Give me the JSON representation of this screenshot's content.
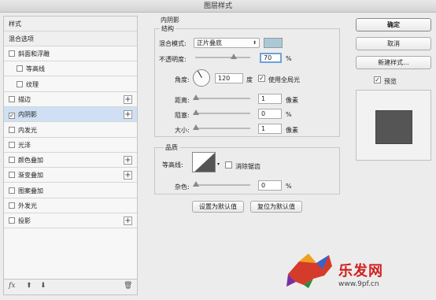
{
  "window": {
    "title": "图层样式"
  },
  "left_panel": {
    "header": "样式",
    "blend_options": "混合选项",
    "items": [
      {
        "label": "斜面和浮雕",
        "checked": false,
        "indent": false,
        "plus": false
      },
      {
        "label": "等高线",
        "checked": false,
        "indent": true,
        "plus": false
      },
      {
        "label": "纹理",
        "checked": false,
        "indent": true,
        "plus": false
      },
      {
        "label": "描边",
        "checked": false,
        "indent": false,
        "plus": true
      },
      {
        "label": "内阴影",
        "checked": true,
        "indent": false,
        "plus": true,
        "selected": true
      },
      {
        "label": "内发光",
        "checked": false,
        "indent": false,
        "plus": false
      },
      {
        "label": "光泽",
        "checked": false,
        "indent": false,
        "plus": false
      },
      {
        "label": "颜色叠加",
        "checked": false,
        "indent": false,
        "plus": true
      },
      {
        "label": "渐变叠加",
        "checked": false,
        "indent": false,
        "plus": true
      },
      {
        "label": "图案叠加",
        "checked": false,
        "indent": false,
        "plus": false
      },
      {
        "label": "外发光",
        "checked": false,
        "indent": false,
        "plus": false
      },
      {
        "label": "投影",
        "checked": false,
        "indent": false,
        "plus": true
      }
    ],
    "footer": {
      "fx": "fx",
      "up": "⬆",
      "down": "⬇",
      "trash": "🗑"
    }
  },
  "inner_shadow": {
    "section_title": "内阴影",
    "structure_title": "结构",
    "blend_mode_label": "混合模式:",
    "blend_mode_value": "正片叠底",
    "shadow_color": "#a9c9d6",
    "opacity_label": "不透明度:",
    "opacity_value": "70",
    "opacity_unit": "%",
    "opacity_level": 0.7,
    "angle_label": "角度:",
    "angle_value": "120",
    "angle_unit": "度",
    "global_light_label": "使用全局光",
    "global_light_checked": true,
    "distance_label": "距离:",
    "distance_value": "1",
    "distance_unit": "像素",
    "choke_label": "阻塞:",
    "choke_value": "0",
    "choke_unit": "%",
    "size_label": "大小:",
    "size_value": "1",
    "size_unit": "像素",
    "quality_title": "品质",
    "contour_label": "等高线:",
    "antialias_label": "消除锯齿",
    "antialias_checked": false,
    "noise_label": "杂色:",
    "noise_value": "0",
    "noise_unit": "%",
    "make_default_label": "设置为默认值",
    "reset_default_label": "复位为默认值"
  },
  "right_panel": {
    "ok_label": "确定",
    "cancel_label": "取消",
    "new_style_label": "新建样式...",
    "preview_label": "预览",
    "preview_checked": true
  },
  "watermark": {
    "brand": "乐发网",
    "url": "www.9pf.cn"
  }
}
